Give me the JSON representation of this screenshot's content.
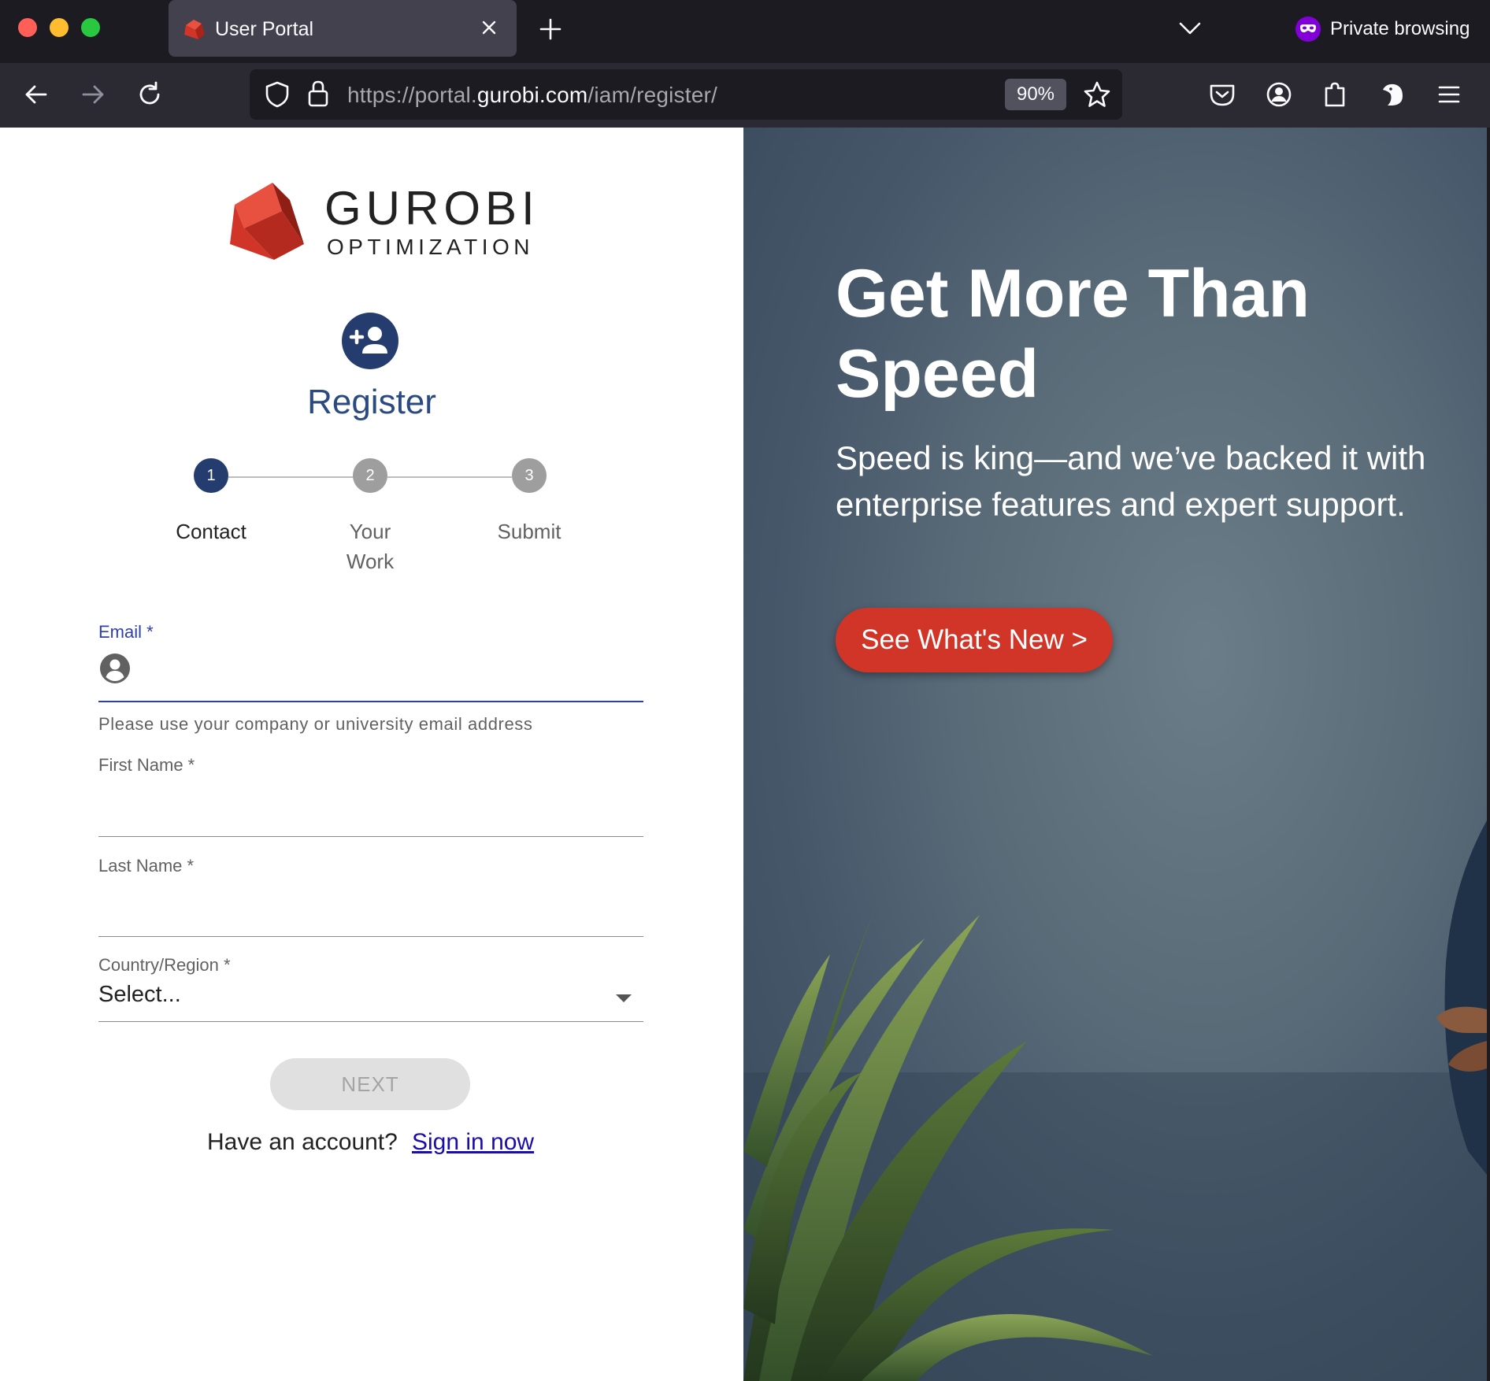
{
  "browser": {
    "tab_title": "User Portal",
    "private_label": "Private browsing",
    "url_prefix": "https://portal.",
    "url_host": "gurobi.com",
    "url_path": "/iam/register/",
    "zoom": "90%"
  },
  "logo": {
    "word": "GUROBI",
    "sub": "OPTIMIZATION",
    "brand_red": "#d03528"
  },
  "register": {
    "title": "Register",
    "steps": [
      {
        "number": "1",
        "label": "Contact"
      },
      {
        "number": "2",
        "label": "Your Work"
      },
      {
        "number": "3",
        "label": "Submit"
      }
    ],
    "active_step": 1
  },
  "form": {
    "email_label": "Email *",
    "email_helper": "Please use your company or university email address",
    "first_name_label": "First Name *",
    "last_name_label": "Last Name *",
    "country_label": "Country/Region *",
    "country_value": "Select...",
    "next_label": "NEXT",
    "have_account": "Have an account?",
    "signin_label": "Sign in now"
  },
  "hero": {
    "title": "Get More Than Speed",
    "subtitle": "Speed is king—and we’ve backed it with enterprise features and expert support.",
    "button_label": "See What's New >"
  },
  "colors": {
    "accent_blue": "#2f3fa8",
    "step_active": "#253d6e",
    "step_inactive": "#9e9e9e",
    "hero_button": "#d03528"
  }
}
